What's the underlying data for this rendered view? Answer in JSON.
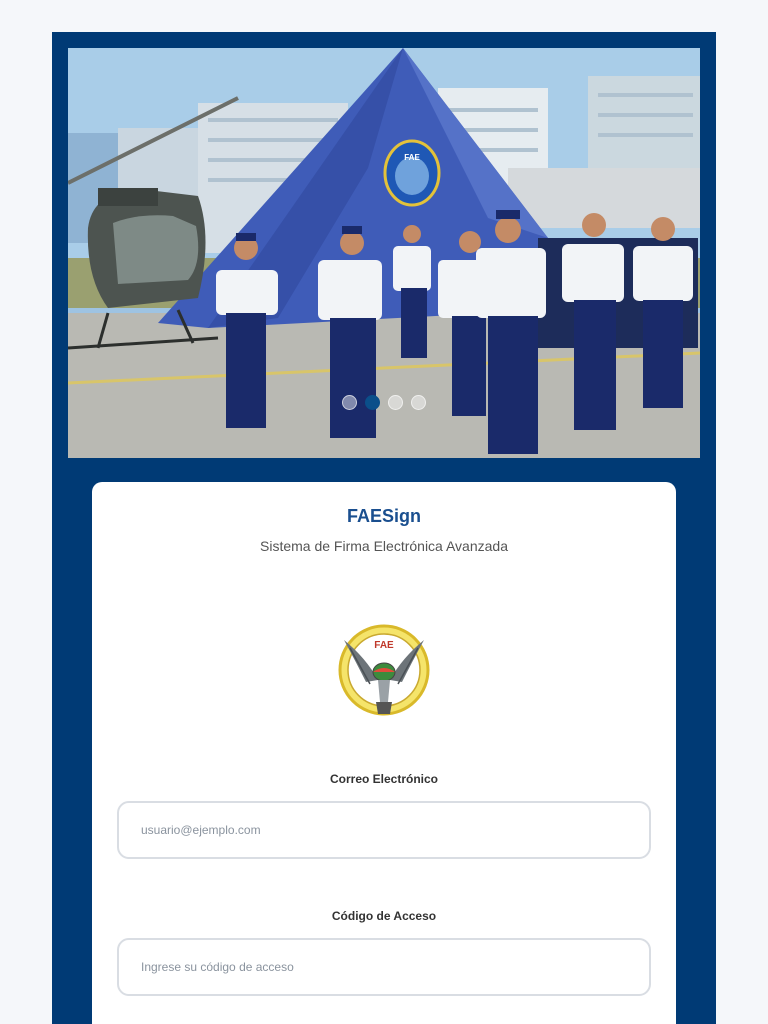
{
  "carousel": {
    "slides": 4,
    "active_index": 1,
    "tent_emblem_text": "FAE"
  },
  "login": {
    "title": "FAESign",
    "subtitle": "Sistema de Firma Electrónica Avanzada",
    "logo_text": "FAE",
    "email_label": "Correo Electrónico",
    "email_placeholder": "usuario@ejemplo.com",
    "code_label": "Código de Acceso",
    "code_placeholder": "Ingrese su código de acceso"
  },
  "colors": {
    "frame": "#003a75",
    "title": "#1a4f8f",
    "active_dot": "#0b4f8a"
  },
  "icons": [
    "fae-emblem-icon",
    "helicopter-icon"
  ]
}
